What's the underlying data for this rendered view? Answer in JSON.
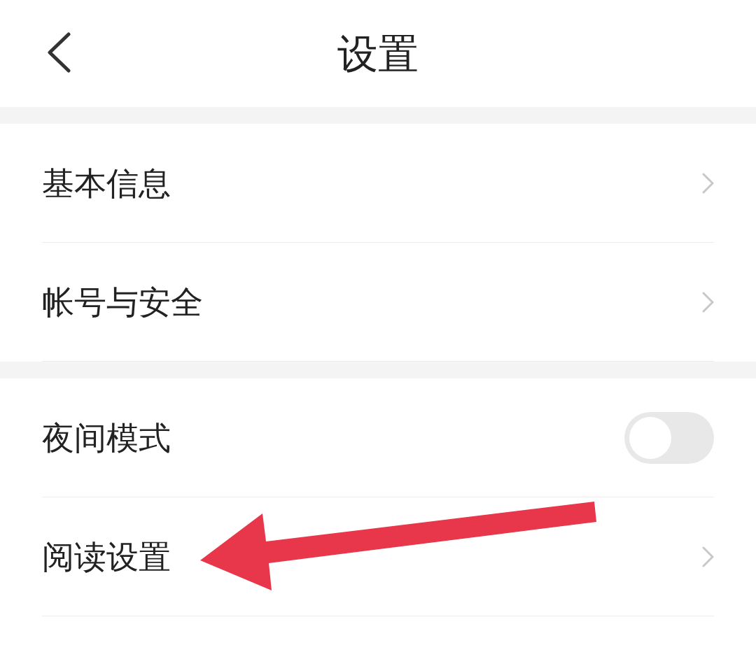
{
  "header": {
    "title": "设置"
  },
  "groups": [
    {
      "items": [
        {
          "kind": "link",
          "label": "基本信息"
        },
        {
          "kind": "link",
          "label": "帐号与安全"
        }
      ]
    },
    {
      "items": [
        {
          "kind": "toggle",
          "label": "夜间模式",
          "on": false
        },
        {
          "kind": "link",
          "label": "阅读设置"
        }
      ]
    }
  ],
  "annotations": [
    {
      "kind": "arrow"
    }
  ]
}
